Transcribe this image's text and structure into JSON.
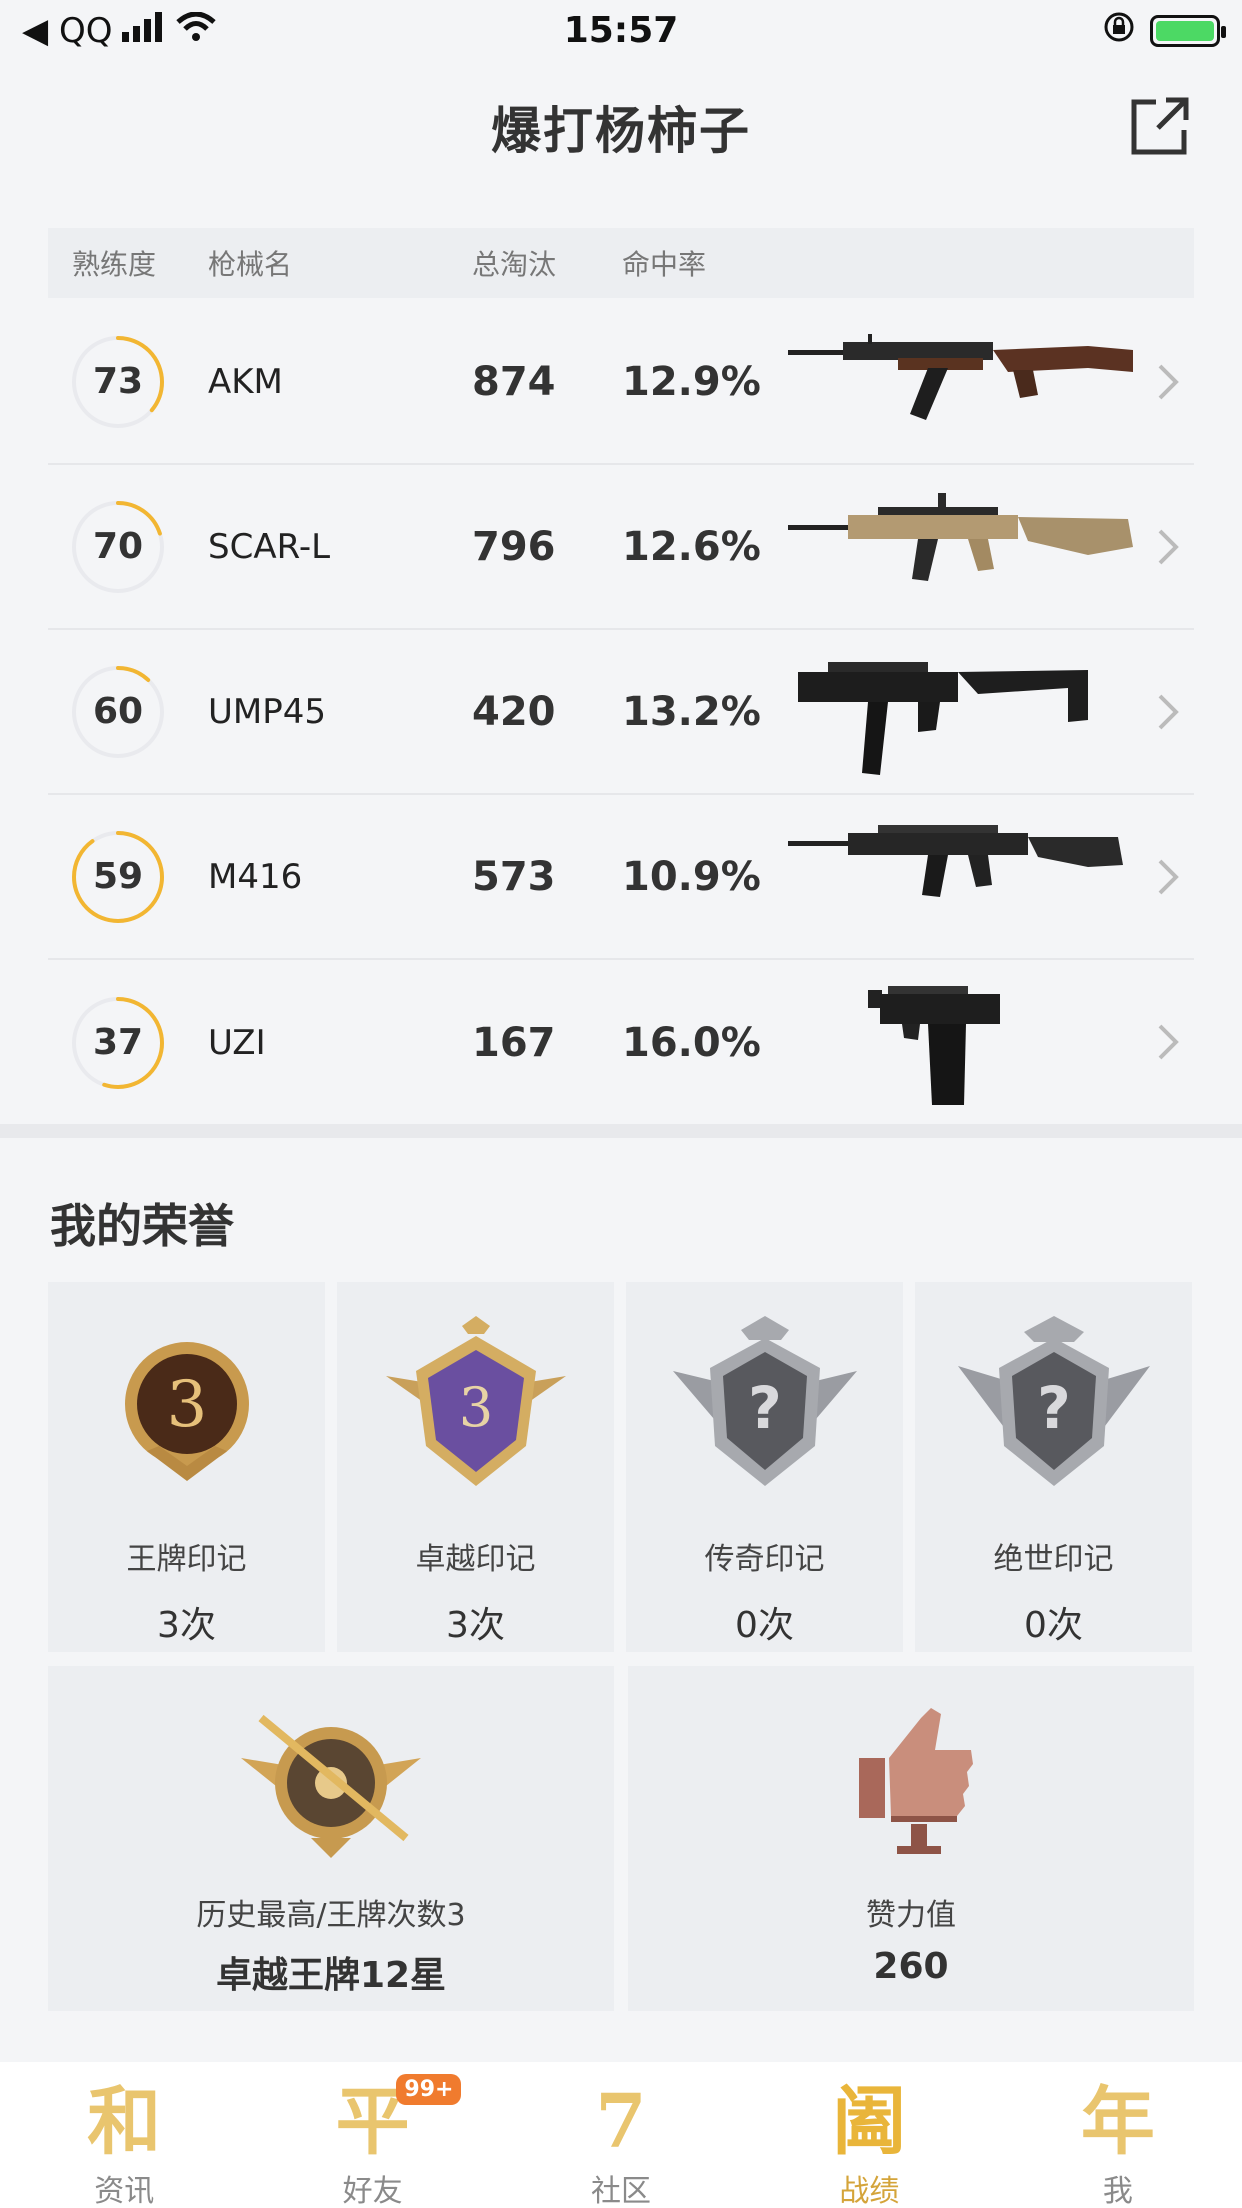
{
  "status_bar": {
    "back_label": "◀ QQ",
    "time": "15:57"
  },
  "header": {
    "title": "爆打杨柿子"
  },
  "weapon_table": {
    "columns": {
      "proficiency": "熟练度",
      "name": "枪械名",
      "kills": "总淘汰",
      "hit_rate": "命中率"
    },
    "rows": [
      {
        "proficiency": "73",
        "proficiency_fraction": 0.36,
        "name": "AKM",
        "kills": "874",
        "hit_rate": "12.9%"
      },
      {
        "proficiency": "70",
        "proficiency_fraction": 0.2,
        "name": "SCAR-L",
        "kills": "796",
        "hit_rate": "12.6%"
      },
      {
        "proficiency": "60",
        "proficiency_fraction": 0.12,
        "name": "UMP45",
        "kills": "420",
        "hit_rate": "13.2%"
      },
      {
        "proficiency": "59",
        "proficiency_fraction": 0.9,
        "name": "M416",
        "kills": "573",
        "hit_rate": "10.9%"
      },
      {
        "proficiency": "37",
        "proficiency_fraction": 0.55,
        "name": "UZI",
        "kills": "167",
        "hit_rate": "16.0%"
      }
    ]
  },
  "honors": {
    "title": "我的荣誉",
    "marks": [
      {
        "label": "王牌印记",
        "count": "3次"
      },
      {
        "label": "卓越印记",
        "count": "3次"
      },
      {
        "label": "传奇印记",
        "count": "0次"
      },
      {
        "label": "绝世印记",
        "count": "0次"
      }
    ],
    "history": {
      "label": "历史最高/王牌次数3",
      "value": "卓越王牌12星"
    },
    "likes": {
      "label": "赞力值",
      "value": "260"
    }
  },
  "tabbar": {
    "tabs": [
      {
        "icon_char": "和",
        "label": "资讯"
      },
      {
        "icon_char": "平",
        "label": "好友",
        "badge": "99+"
      },
      {
        "icon_char": "7",
        "label": "社区"
      },
      {
        "icon_char": "阖",
        "label": "战绩"
      },
      {
        "icon_char": "年",
        "label": "我"
      }
    ]
  },
  "colors": {
    "accent": "#f2b632",
    "ring_track": "#e9eaee",
    "badge_orange": "#f07b2e"
  }
}
